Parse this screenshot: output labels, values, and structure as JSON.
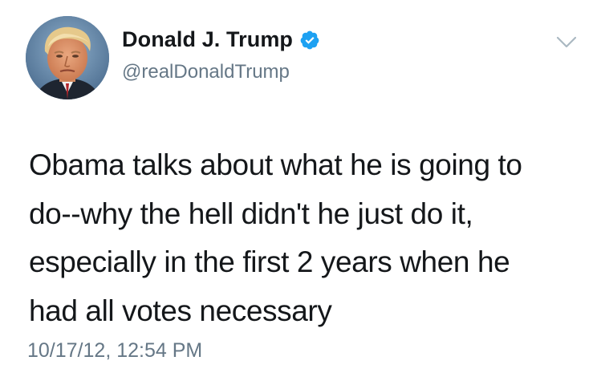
{
  "tweet": {
    "author": {
      "display_name": "Donald J. Trump",
      "handle": "@realDonaldTrump",
      "verified": true
    },
    "text_lines": [
      "Obama talks about what he is going to",
      "do--why the hell didn't he just do it,",
      "especially in the first 2 years when he",
      "had all votes necessary"
    ],
    "timestamp": "10/17/12, 12:54 PM"
  },
  "icons": {
    "verified": "verified-badge-icon",
    "more": "chevron-down-icon"
  },
  "colors": {
    "text_primary": "#14171a",
    "text_secondary": "#657786",
    "verified_blue": "#1da1f2",
    "background": "#ffffff"
  }
}
